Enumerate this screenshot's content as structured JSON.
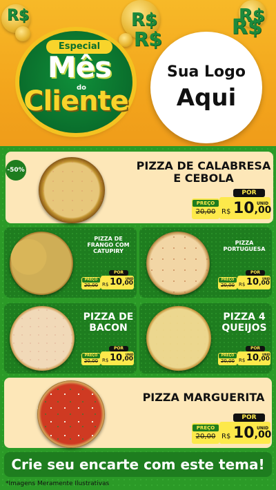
{
  "header": {
    "currency_symbol": "R$",
    "seal_tag": "Especial",
    "seal_line1": "Mês",
    "seal_do": "do",
    "seal_line2": "Cliente",
    "logo_line1": "Sua Logo",
    "logo_line2": "Aqui"
  },
  "badge": "-50%",
  "price_labels": {
    "preco": "PREÇO",
    "por": "POR",
    "rs": "R$",
    "unid": "UNID"
  },
  "items": [
    {
      "name_line1": "PIZZA DE CALABRESA",
      "name_line2": "E CEBOLA",
      "old_price": "20,00",
      "price_int": "10",
      "price_dec": ",00"
    },
    {
      "name_line1": "PIZZA DE",
      "name_line2": "FRANGO COM",
      "name_line3": "CATUPIRY",
      "old_price": "20,00",
      "price_int": "10",
      "price_dec": ",00"
    },
    {
      "name_line1": "PIZZA",
      "name_line2": "PORTUGUESA",
      "old_price": "20,00",
      "price_int": "10",
      "price_dec": ",00"
    },
    {
      "name_line1": "PIZZA DE",
      "name_line2": "BACON",
      "old_price": "20,00",
      "price_int": "10",
      "price_dec": ",00"
    },
    {
      "name_line1": "PIZZA 4",
      "name_line2": "QUEIJOS",
      "old_price": "20,00",
      "price_int": "10",
      "price_dec": ",00"
    },
    {
      "name_line1": "PIZZA MARGUERITA",
      "old_price": "20,00",
      "price_int": "10",
      "price_dec": ",00"
    }
  ],
  "cta": "Crie seu encarte com este tema!",
  "footnote": "*Imagens Meramente Ilustrativas",
  "colors": {
    "brand_green": "#1e7d1f",
    "accent_yellow": "#fde94b",
    "header_orange": "#f3a51c",
    "cream": "#fde7b8"
  }
}
